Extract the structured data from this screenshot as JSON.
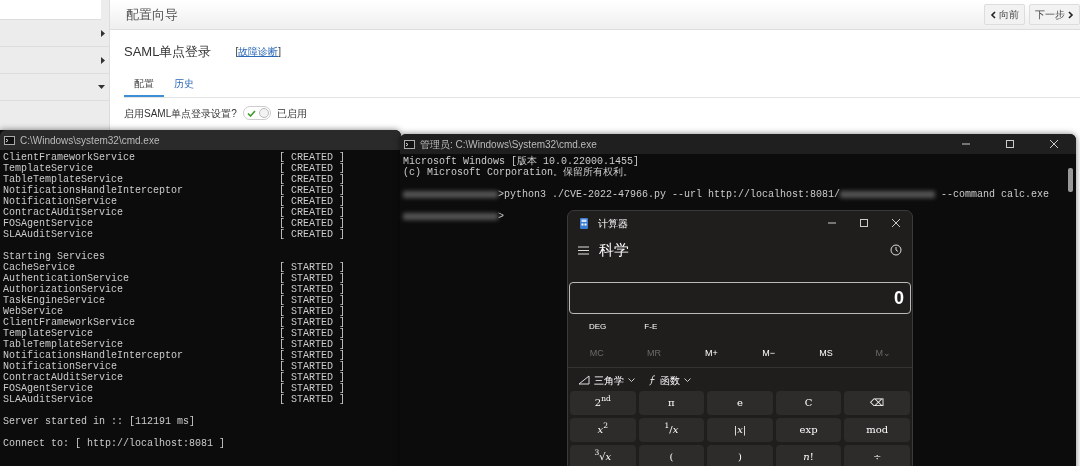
{
  "web_page": {
    "sidebar_items": [
      {
        "expanded": false
      },
      {
        "expanded": false
      },
      {
        "expanded": true
      }
    ],
    "header_title": "配置向导",
    "nav_buttons": [
      {
        "label": "向前",
        "kind": "prev"
      },
      {
        "label": "下一步",
        "kind": "next"
      }
    ],
    "section_title": "SAML单点登录",
    "diagnose_brackets": [
      "[",
      "]"
    ],
    "diagnose_link": "故障诊断",
    "tabs": [
      {
        "label": "配置",
        "selected": true
      },
      {
        "label": "历史",
        "selected": false
      }
    ],
    "toggle": {
      "label": "启用SAML单点登录设置?",
      "on": true,
      "status": "已启用"
    }
  },
  "console_left": {
    "title": "C:\\Windows\\system32\\cmd.exe",
    "lines": [
      {
        "kind": "service",
        "text": "ClientFrameworkService",
        "status": "[ CREATED ]"
      },
      {
        "kind": "service",
        "text": "TemplateService",
        "status": "[ CREATED ]"
      },
      {
        "kind": "service",
        "text": "TableTemplateService",
        "status": "[ CREATED ]"
      },
      {
        "kind": "service",
        "text": "NotificationsHandleInterceptor",
        "status": "[ CREATED ]"
      },
      {
        "kind": "service",
        "text": "NotificationService",
        "status": "[ CREATED ]"
      },
      {
        "kind": "service",
        "text": "ContractAUditService",
        "status": "[ CREATED ]"
      },
      {
        "kind": "service",
        "text": "FOSAgentService",
        "status": "[ CREATED ]"
      },
      {
        "kind": "service",
        "text": "SLAAuditService",
        "status": "[ CREATED ]"
      },
      {
        "kind": "heading",
        "text": "Starting Services"
      },
      {
        "kind": "service",
        "text": "CacheService",
        "status": "[ STARTED ]"
      },
      {
        "kind": "service",
        "text": "AuthenticationService",
        "status": "[ STARTED ]"
      },
      {
        "kind": "service",
        "text": "AuthorizationService",
        "status": "[ STARTED ]"
      },
      {
        "kind": "service",
        "text": "TaskEngineService",
        "status": "[ STARTED ]"
      },
      {
        "kind": "service",
        "text": "WebService",
        "status": "[ STARTED ]"
      },
      {
        "kind": "service",
        "text": "ClientFrameworkService",
        "status": "[ STARTED ]"
      },
      {
        "kind": "service",
        "text": "TemplateService",
        "status": "[ STARTED ]"
      },
      {
        "kind": "service",
        "text": "TableTemplateService",
        "status": "[ STARTED ]"
      },
      {
        "kind": "service",
        "text": "NotificationsHandleInterceptor",
        "status": "[ STARTED ]"
      },
      {
        "kind": "service",
        "text": "NotificationService",
        "status": "[ STARTED ]"
      },
      {
        "kind": "service",
        "text": "ContractAUditService",
        "status": "[ STARTED ]"
      },
      {
        "kind": "service",
        "text": "FOSAgentService",
        "status": "[ STARTED ]"
      },
      {
        "kind": "service",
        "text": "SLAAuditService",
        "status": "[ STARTED ]"
      },
      {
        "kind": "info",
        "text": "Server started in :: [112191 ms]"
      },
      {
        "kind": "info",
        "text": "Connect to: [ http://localhost:8081 ]"
      }
    ]
  },
  "console_right": {
    "title": "管理员: C:\\Windows\\System32\\cmd.exe",
    "lines": [
      {
        "segments": [
          {
            "kind": "text",
            "text": "Microsoft Windows [版本 10.0.22000.1455]"
          }
        ]
      },
      {
        "segments": [
          {
            "kind": "text",
            "text": "(c) Microsoft Corporation。保留所有权利。"
          }
        ]
      },
      {
        "segments": [
          {
            "kind": "redacted"
          },
          {
            "kind": "text",
            "text": ">python3 ./CVE-2022-47966.py --url http://localhost:8081/"
          },
          {
            "kind": "redacted"
          },
          {
            "kind": "text",
            "text": " --command calc.exe"
          }
        ]
      },
      {
        "segments": [
          {
            "kind": "redacted"
          },
          {
            "kind": "text",
            "text": ">"
          }
        ]
      }
    ]
  },
  "calculator": {
    "title": "计算器",
    "mode": "科学",
    "display": "0",
    "options": [
      "DEG",
      "F-E"
    ],
    "memory": [
      {
        "label": "MC",
        "disabled": true
      },
      {
        "label": "MR",
        "disabled": true
      },
      {
        "label": "M+",
        "disabled": false
      },
      {
        "label": "M−",
        "disabled": false
      },
      {
        "label": "MS",
        "disabled": false
      },
      {
        "label": "M⌄",
        "disabled": true
      }
    ],
    "menus": [
      {
        "label": "三角学",
        "kind": "trig"
      },
      {
        "label": "函数",
        "kind": "func"
      }
    ],
    "keys": [
      [
        "2$^{nd}$",
        "π",
        "e",
        "C",
        "⌫"
      ],
      [
        "*x*$^{2}$",
        "$^{1}$/*x*",
        "|*x*|",
        "exp",
        "mod"
      ],
      [
        "$^{3}$√*x*",
        "(",
        ")",
        "*n*!",
        "÷"
      ]
    ]
  }
}
